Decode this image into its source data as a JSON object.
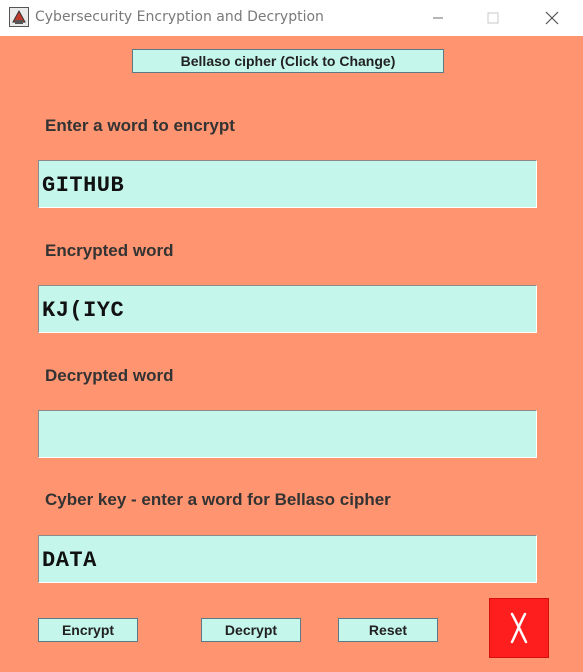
{
  "window": {
    "title": "Cybersecurity Encryption and Decryption",
    "icon": "java-cup-icon"
  },
  "cipher_toggle": {
    "label": "Bellaso cipher (Click to Change)"
  },
  "encrypt_input": {
    "label": "Enter a word to encrypt",
    "value": "GITHUB"
  },
  "encrypted_output": {
    "label": "Encrypted word",
    "value": "KJ(IYC"
  },
  "decrypted_output": {
    "label": "Decrypted word",
    "value": ""
  },
  "key_input": {
    "label": "Cyber key - enter a word for Bellaso cipher",
    "value": "DATA"
  },
  "buttons": {
    "encrypt": "Encrypt",
    "decrypt": "Decrypt",
    "reset": "Reset",
    "exit_icon": "exit-x-icon"
  },
  "colors": {
    "background": "#ff9470",
    "field": "#c4f6eb",
    "exit": "#ff1e1e"
  }
}
